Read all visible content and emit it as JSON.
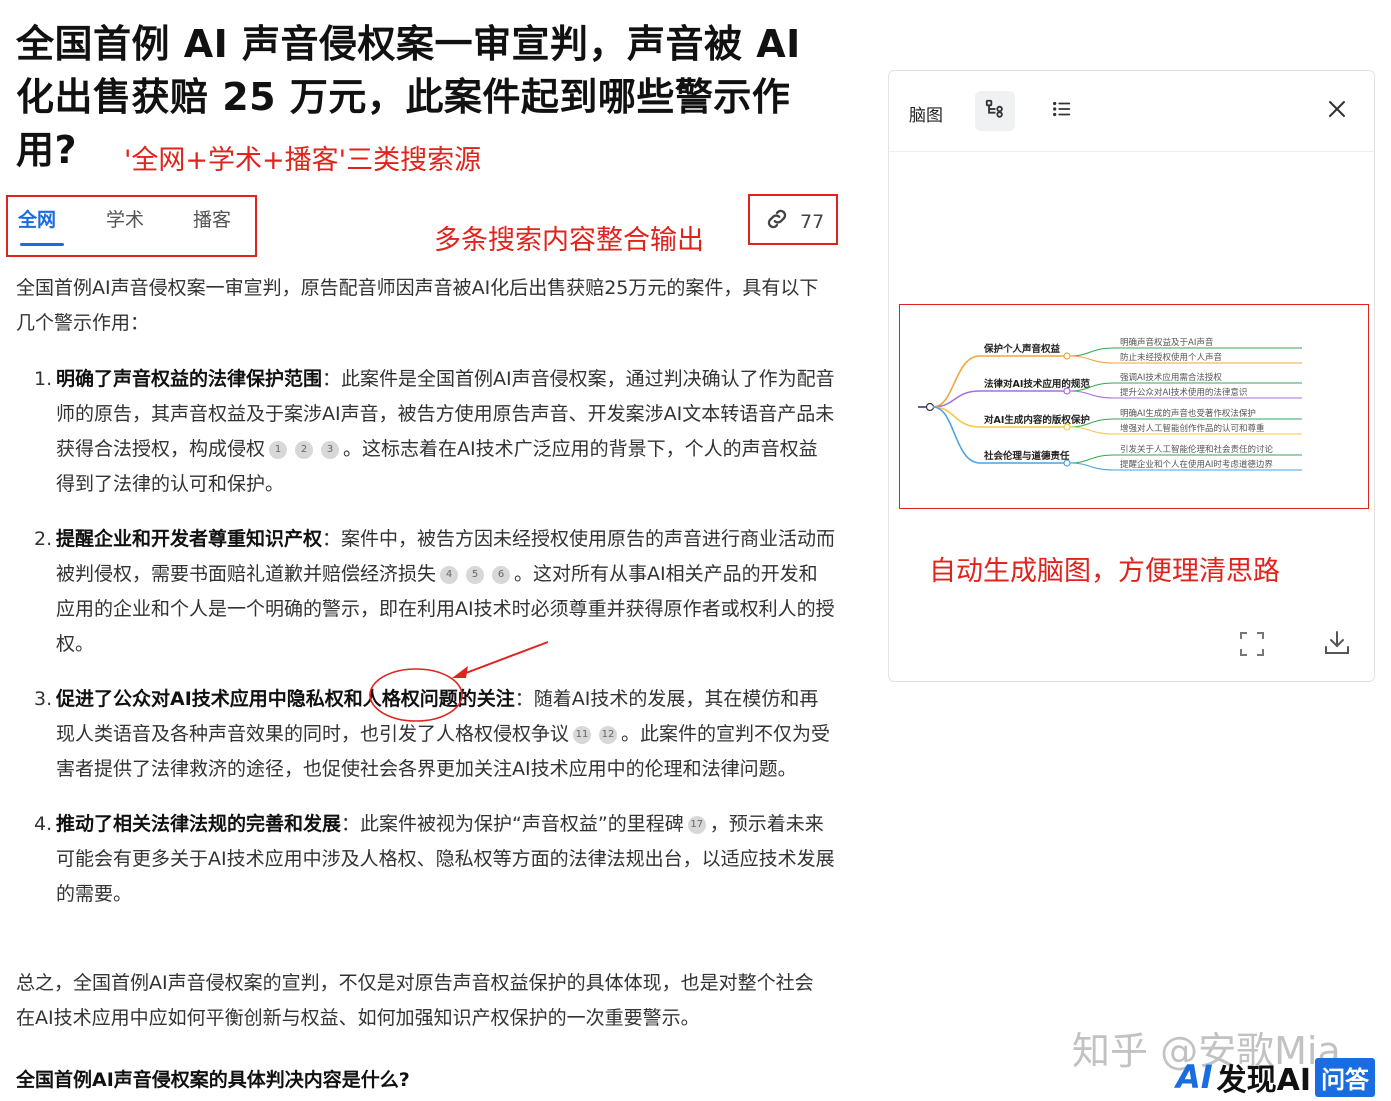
{
  "page_title": "全国首例 AI 声音侵权案一审宣判，声音被 AI 化出售获赔 25 万元，此案件起到哪些警示作用?",
  "annotations": {
    "sources": "'全网+学术+播客'三类搜索源",
    "integrate": "多条搜索内容整合输出",
    "mindmap": "自动生成脑图，方便理清思路"
  },
  "tabs": [
    {
      "label": "全网",
      "active": true
    },
    {
      "label": "学术",
      "active": false
    },
    {
      "label": "播客",
      "active": false
    }
  ],
  "cite_count": "77",
  "intro": "全国首例AI声音侵权案一审宣判，原告配音师因声音被AI化后出售获赔25万元的案件，具有以下几个警示作用：",
  "points": [
    {
      "num": "1.",
      "heading": "明确了声音权益的法律保护范围",
      "text_a": "：此案件是全国首例AI声音侵权案，通过判决确认了作为配音师的原告，其声音权益及于案涉AI声音，被告方使用原告声音、开发案涉AI文本转语音产品未获得合法授权，构成侵权",
      "cites": [
        "1",
        "2",
        "3"
      ],
      "text_b": "。这标志着在AI技术广泛应用的背景下，个人的声音权益得到了法律的认可和保护。"
    },
    {
      "num": "2.",
      "heading": "提醒企业和开发者尊重知识产权",
      "text_a": "：案件中，被告方因未经授权使用原告的声音进行商业活动而被判侵权，需要书面赔礼道歉并赔偿经济损失",
      "cites": [
        "4",
        "5",
        "6"
      ],
      "text_b": "。这对所有从事AI相关产品的开发和应用的企业和个人是一个明确的警示，即在利用AI技术时必须尊重并获得原作者或权利人的授权。"
    },
    {
      "num": "3.",
      "heading": "促进了公众对AI技术应用中隐私权和人格权问题的关注",
      "text_a": "：随着AI技术的发展，其在模仿和再现人类语音及各种声音效果的同时，也引发了人格权侵权争议",
      "cites": [
        "11",
        "12"
      ],
      "text_b": "。此案件的宣判不仅为受害者提供了法律救济的途径，也促使社会各界更加关注AI技术应用中的伦理和法律问题。"
    },
    {
      "num": "4.",
      "heading": "推动了相关法律法规的完善和发展",
      "text_a": "：此案件被视为保护“声音权益”的里程碑",
      "cites": [
        "17"
      ],
      "text_b": "，预示着未来可能会有更多关于AI技术应用中涉及人格权、隐私权等方面的法律法规出台，以适应技术发展的需要。"
    }
  ],
  "conclusion": "总之，全国首例AI声音侵权案的宣判，不仅是对原告声音权益保护的具体体现，也是对整个社会在AI技术应用中应如何平衡创新与权益、如何加强知识产权保护的一次重要警示。",
  "followup_question": "全国首例AI声音侵权案的具体判决内容是什么?",
  "panel": {
    "title": "脑图",
    "mindmap": [
      {
        "label": "保护个人声音权益",
        "children": [
          "明确声音权益及于AI声音",
          "防止未经授权使用个人声音"
        ]
      },
      {
        "label": "法律对AI技术应用的规范",
        "children": [
          "强调AI技术应用需合法授权",
          "提升公众对AI技术使用的法律意识"
        ]
      },
      {
        "label": "对AI生成内容的版权保护",
        "children": [
          "明确AI生成的声音也受著作权法保护",
          "增强对人工智能创作作品的认可和尊重"
        ]
      },
      {
        "label": "社会伦理与道德责任",
        "children": [
          "引发关于人工智能伦理和社会责任的讨论",
          "提醒企业和个人在使用AI时考虑道德边界"
        ]
      }
    ],
    "colors": {
      "branch1": "#f0a63a",
      "branch2": "#a86de0",
      "branch3": "#f5c94a",
      "branch4": "#4aa3e0"
    }
  },
  "watermark": "知乎 @安歌Mia",
  "brand": {
    "logo": "AI",
    "name": "发现AI",
    "badge": "问答"
  }
}
